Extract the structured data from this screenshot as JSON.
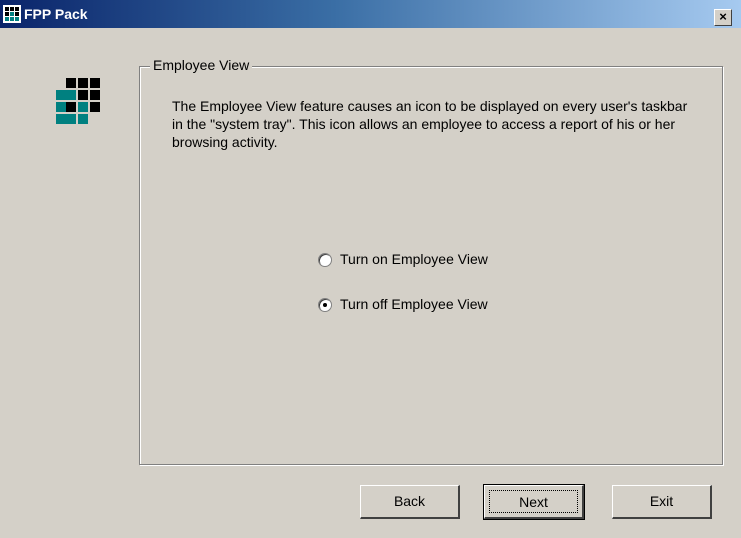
{
  "window": {
    "title": "FPP Pack",
    "close_glyph": "×",
    "icon": "grid-logo-icon"
  },
  "colors": {
    "titlebar_start": "#0a246a",
    "titlebar_end": "#a6caf0",
    "face": "#d4d0c8",
    "logo_dark": "#000000",
    "logo_teal": "#008080"
  },
  "group": {
    "legend": "Employee View",
    "description": "The Employee View feature causes an icon to be displayed on every user's taskbar in the \"system tray\".  This icon allows an employee to access a report of his or her browsing activity."
  },
  "options": [
    {
      "label": "Turn on Employee View",
      "selected": false
    },
    {
      "label": "Turn off Employee View",
      "selected": true
    }
  ],
  "buttons": {
    "back": "Back",
    "next": "Next",
    "exit": "Exit"
  }
}
